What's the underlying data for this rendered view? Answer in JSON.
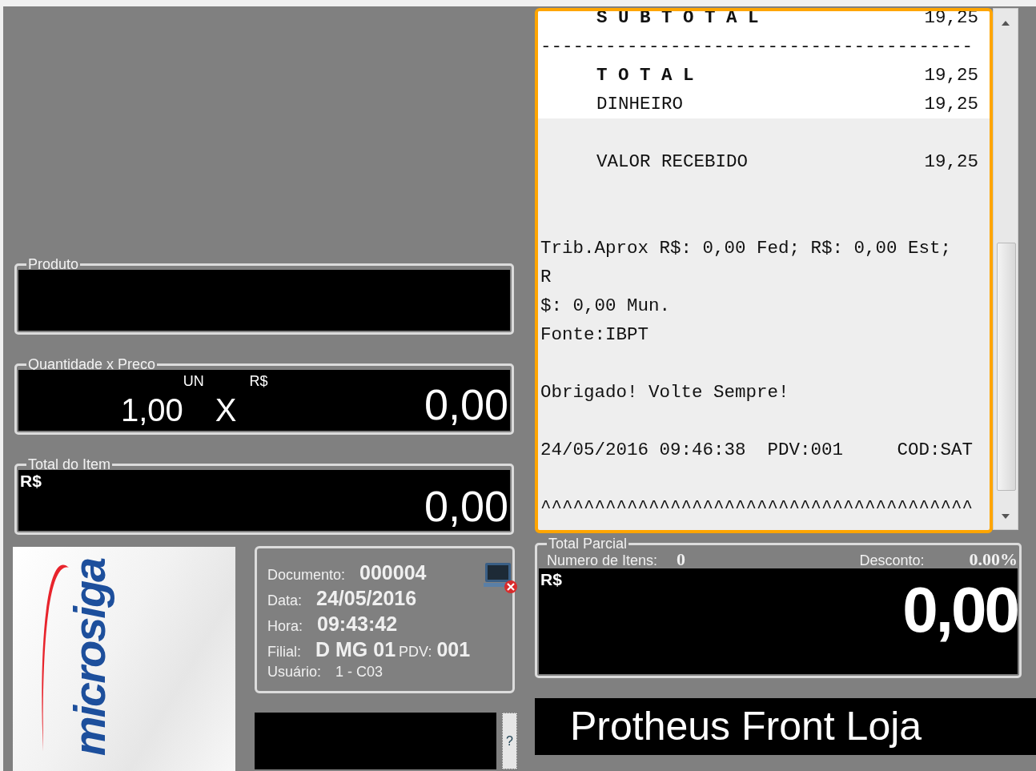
{
  "product": {
    "label": "Produto"
  },
  "quantity_price": {
    "label": "Quantidade x Preco",
    "quantity": "1,00",
    "unit": "UN",
    "times": "X",
    "currency": "R$",
    "price": "0,00"
  },
  "item_total": {
    "label": "Total do Item",
    "currency": "R$",
    "value": "0,00"
  },
  "receipt": {
    "lines": [
      {
        "kind": "pair",
        "label": "S U B T O T A L",
        "value": "19,25",
        "bold": true,
        "highlighted": true
      },
      {
        "kind": "text",
        "text": "----------------------------------------",
        "highlighted": true
      },
      {
        "kind": "pair",
        "label": "T O T A L",
        "value": "19,25",
        "bold": true,
        "highlighted": true
      },
      {
        "kind": "pair",
        "label": "DINHEIRO",
        "value": "19,25",
        "bold": false,
        "highlighted": true
      },
      {
        "kind": "blank",
        "highlighted": false
      },
      {
        "kind": "pair",
        "label": "VALOR RECEBIDO",
        "value": "19,25",
        "bold": false,
        "highlighted": false
      },
      {
        "kind": "blank",
        "highlighted": false
      },
      {
        "kind": "blank",
        "highlighted": false
      },
      {
        "kind": "text",
        "text": "Trib.Aprox R$: 0,00 Fed; R$: 0,00 Est;",
        "highlighted": false
      },
      {
        "kind": "text",
        "text": "R",
        "highlighted": false
      },
      {
        "kind": "text",
        "text": "$: 0,00 Mun.",
        "highlighted": false
      },
      {
        "kind": "text",
        "text": "Fonte:IBPT",
        "highlighted": false
      },
      {
        "kind": "blank",
        "highlighted": false
      },
      {
        "kind": "text",
        "text": "Obrigado! Volte Sempre!",
        "highlighted": false
      },
      {
        "kind": "blank",
        "highlighted": false
      },
      {
        "kind": "text",
        "text": "24/05/2016 09:46:38  PDV:001     COD:SAT",
        "highlighted": false
      },
      {
        "kind": "blank",
        "highlighted": false
      },
      {
        "kind": "text",
        "text": "^^^^^^^^^^^^^^^^^^^^^^^^^^^^^^^^^^^^^^^^",
        "highlighted": false
      }
    ]
  },
  "logo": {
    "text": "microsiga"
  },
  "sale_info": {
    "rows": [
      {
        "kind": "strong",
        "label": "Documento:",
        "value": "000004"
      },
      {
        "kind": "strong",
        "label": "Data:",
        "value": "24/05/2016"
      },
      {
        "kind": "strong",
        "label": "Hora:",
        "value": "09:43:42"
      },
      {
        "kind": "branch",
        "label": "Filial:",
        "value": "D MG 01",
        "extra_label": "PDV:",
        "extra_value": "001"
      },
      {
        "kind": "plain",
        "label": "Usuário:",
        "value": "1 - C03"
      }
    ]
  },
  "help_button": {
    "label": "?"
  },
  "partial_total": {
    "label": "Total Parcial",
    "items_label": "Numero de Itens:",
    "items_value": "0",
    "discount_label": "Desconto:",
    "discount_value": "0.00%",
    "currency": "R$",
    "value": "0,00"
  },
  "banner": {
    "title": "Protheus Front Loja"
  }
}
